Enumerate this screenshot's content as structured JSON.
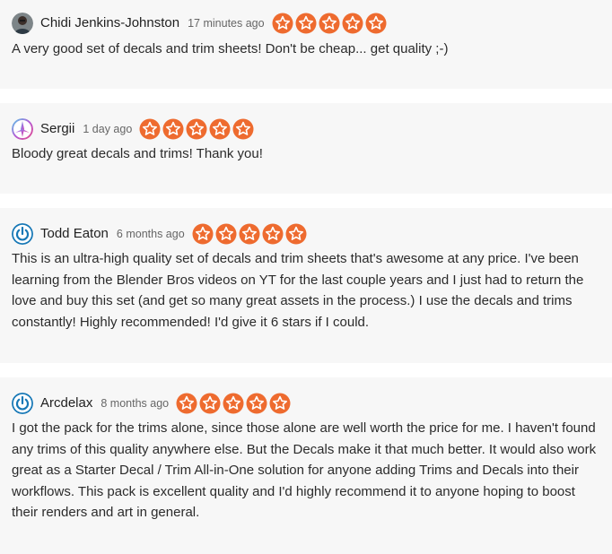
{
  "colors": {
    "card_background": "#f7f7f7",
    "star_fill": "#ee6b2f",
    "star_outline": "#ffffff",
    "text": "#2b2b2b",
    "muted": "#666666"
  },
  "reviews": [
    {
      "name": "Chidi Jenkins-Johnston",
      "time": "17 minutes ago",
      "rating": 5,
      "text": "A very good set of decals and trim sheets! Don't be cheap... get quality ;-)",
      "avatar": "photo-avatar"
    },
    {
      "name": "Sergii",
      "time": "1 day ago",
      "rating": 5,
      "text": "Bloody great decals and trims! Thank you!",
      "avatar": "gradient-logo-avatar"
    },
    {
      "name": "Todd Eaton",
      "time": "6 months ago",
      "rating": 5,
      "text": "This is an ultra-high quality set of decals and trim sheets that's awesome at any price. I've been learning from the Blender Bros videos on YT for the last couple years and I just had to return the love and buy this set (and get so many great assets in the process.) I use the decals and trims constantly! Highly recommended! I'd give it 6 stars if I could.",
      "avatar": "power-icon-avatar"
    },
    {
      "name": "Arcdelax",
      "time": "8 months ago",
      "rating": 5,
      "text": "I got the pack for the trims alone, since those alone are well worth the price for me. I haven't found any trims of this quality anywhere else. But the Decals make it that much better. It would also work great as a Starter Decal / Trim All-in-One solution for anyone adding Trims and Decals into their workflows. This pack is excellent quality and I'd highly recommend it to anyone hoping to boost their renders and art in general.",
      "avatar": "power-icon-avatar"
    }
  ]
}
